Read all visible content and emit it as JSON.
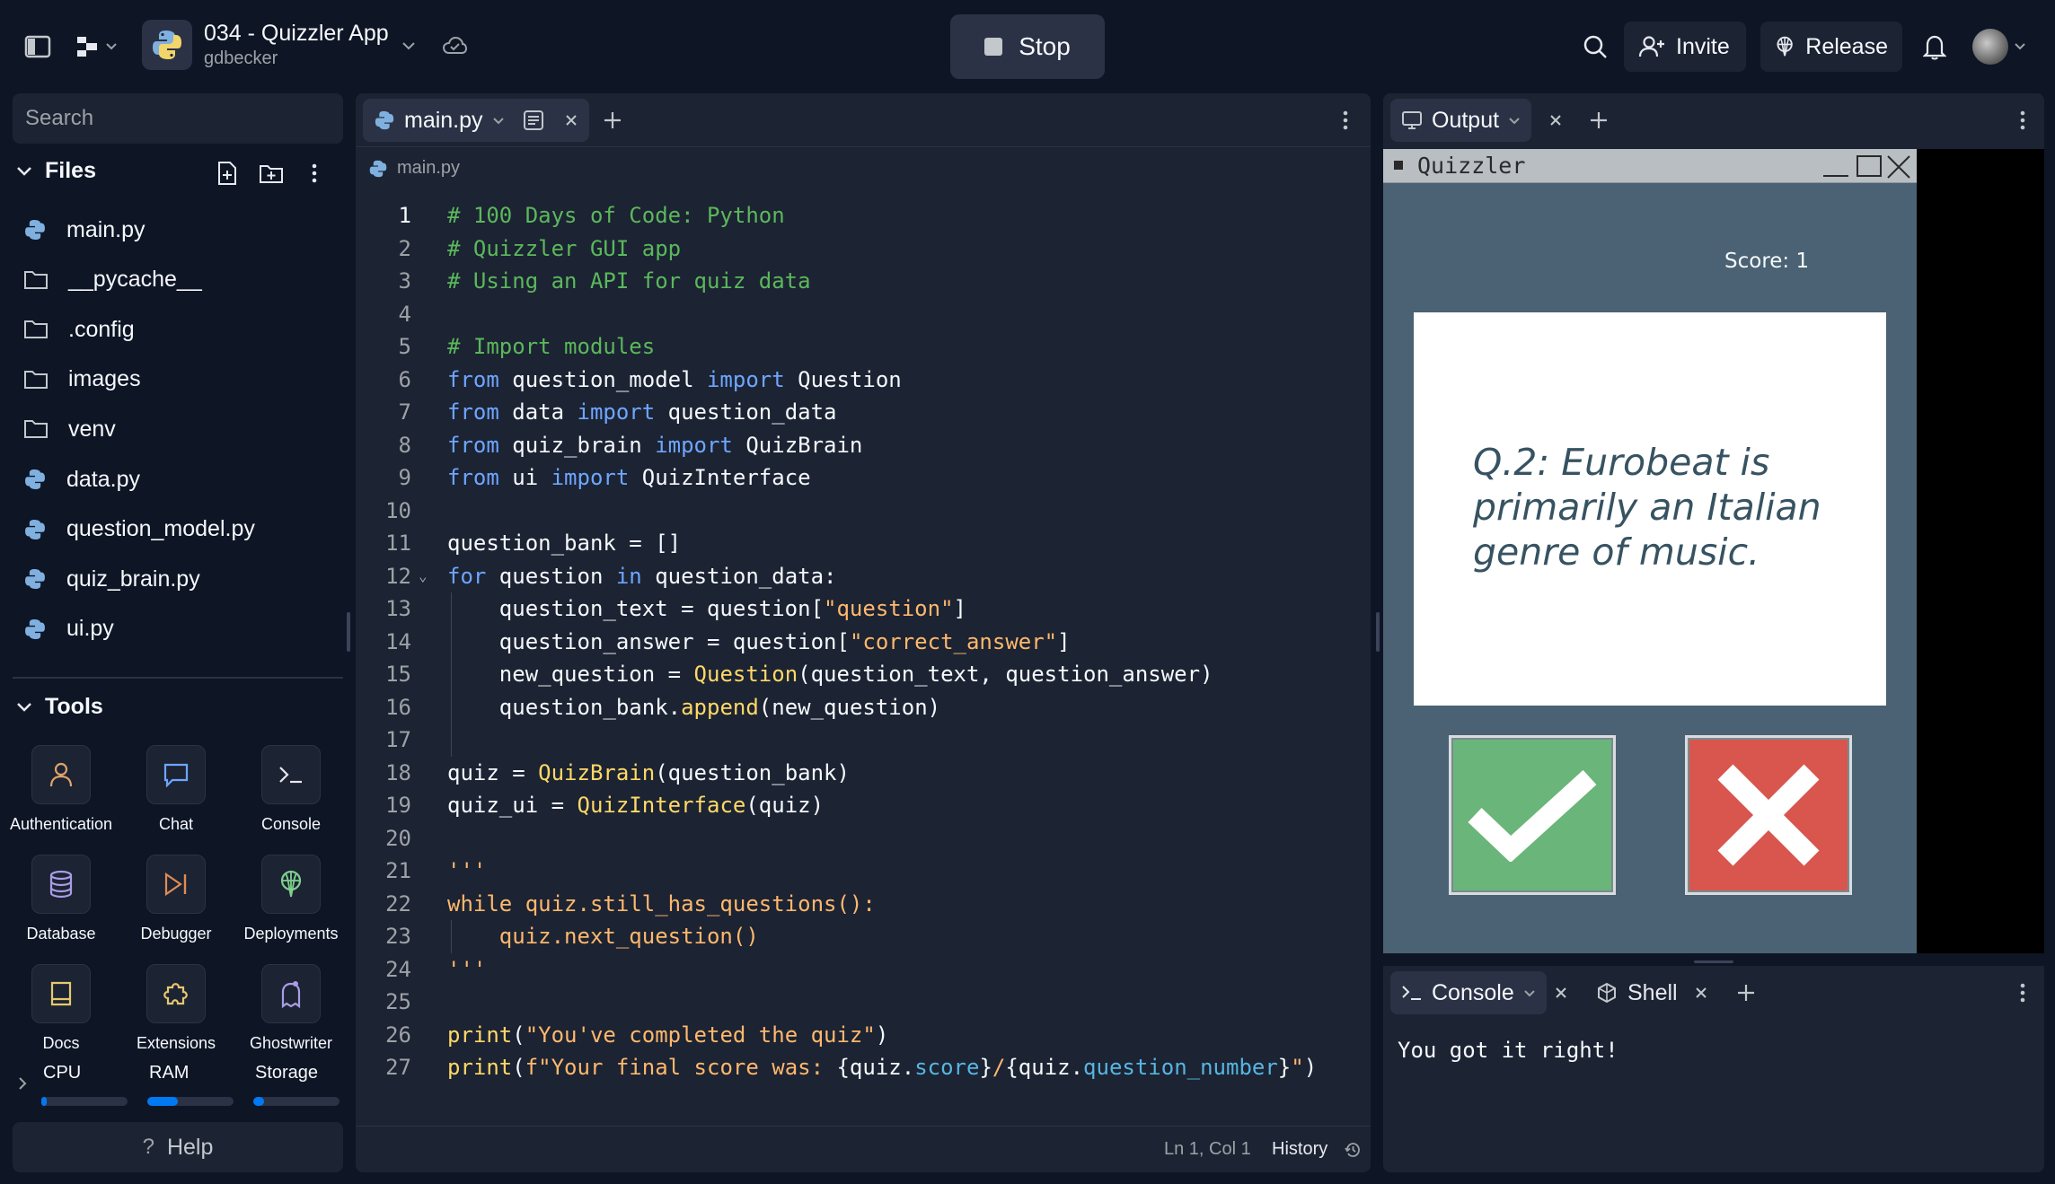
{
  "topbar": {
    "repl_title": "034 - Quizzler App",
    "repl_owner": "gdbecker",
    "run_label": "Stop",
    "invite_label": "Invite",
    "release_label": "Release"
  },
  "sidebar": {
    "search_placeholder": "Search",
    "files_header": "Files",
    "files": [
      {
        "name": "main.py",
        "type": "python"
      },
      {
        "name": "__pycache__",
        "type": "folder"
      },
      {
        "name": ".config",
        "type": "folder"
      },
      {
        "name": "images",
        "type": "folder"
      },
      {
        "name": "venv",
        "type": "folder"
      },
      {
        "name": "data.py",
        "type": "python"
      },
      {
        "name": "question_model.py",
        "type": "python"
      },
      {
        "name": "quiz_brain.py",
        "type": "python"
      },
      {
        "name": "ui.py",
        "type": "python"
      }
    ],
    "tools_header": "Tools",
    "tools": [
      {
        "label": "Authentication",
        "icon": "user-icon"
      },
      {
        "label": "Chat",
        "icon": "chat-icon"
      },
      {
        "label": "Console",
        "icon": "terminal-icon"
      },
      {
        "label": "Database",
        "icon": "database-icon"
      },
      {
        "label": "Debugger",
        "icon": "debugger-icon"
      },
      {
        "label": "Deployments",
        "icon": "deployments-icon"
      },
      {
        "label": "Docs",
        "icon": "book-icon"
      },
      {
        "label": "Extensions",
        "icon": "puzzle-icon"
      },
      {
        "label": "Ghostwriter",
        "icon": "ghostwriter-icon"
      }
    ],
    "resources": [
      {
        "label": "CPU",
        "level": 0.06
      },
      {
        "label": "RAM",
        "level": 0.35
      },
      {
        "label": "Storage",
        "level": 0.12
      }
    ],
    "help_label": "Help"
  },
  "editor": {
    "tab_label": "main.py",
    "breadcrumb": "main.py",
    "current_line": 1,
    "status_position": "Ln 1, Col 1",
    "history_label": "History",
    "code_lines": [
      "1",
      "2",
      "3",
      "4",
      "5",
      "6",
      "7",
      "8",
      "9",
      "10",
      "11",
      "12",
      "13",
      "14",
      "15",
      "16",
      "17",
      "18",
      "19",
      "20",
      "21",
      "22",
      "23",
      "24",
      "25",
      "26",
      "27"
    ]
  },
  "output": {
    "tab_label": "Output",
    "window_title": "Quizzler",
    "score_text": "Score: 1",
    "question_text": "Q.2: Eurobeat is primarily an Italian genre of music.",
    "true_icon": "checkmark-icon",
    "false_icon": "cross-icon"
  },
  "console": {
    "tab_label": "Console",
    "shell_label": "Shell",
    "output_text": "You got it right!"
  },
  "colors": {
    "background": "#0e1525",
    "panel": "#1c2333",
    "accent": "#0079f2",
    "quiz_background": "#4a6273",
    "true_green": "#6ab579",
    "false_red": "#d8564d"
  }
}
